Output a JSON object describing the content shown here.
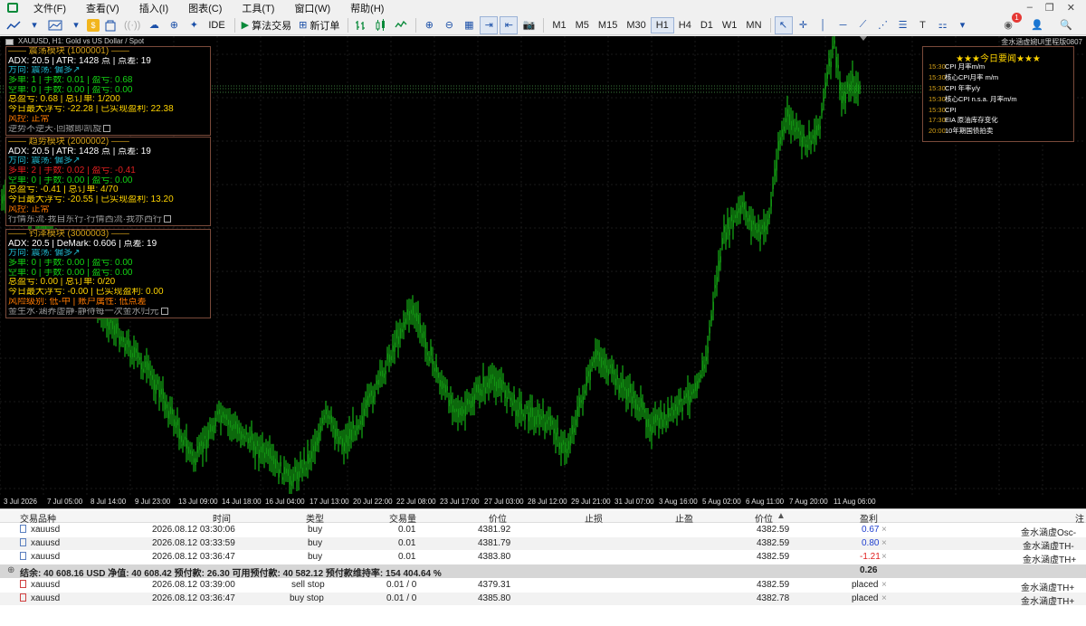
{
  "menu": {
    "items": [
      "文件(F)",
      "查看(V)",
      "插入(I)",
      "图表(C)",
      "工具(T)",
      "窗口(W)",
      "帮助(H)"
    ]
  },
  "toolbar": {
    "ide_label": "IDE",
    "algo_label": "算法交易",
    "new_order_label": "新订单",
    "timeframes": [
      "M1",
      "M5",
      "M15",
      "M30",
      "H1",
      "H4",
      "D1",
      "W1",
      "MN"
    ],
    "active_timeframe": "H1",
    "notification_count": "1"
  },
  "chart": {
    "title": "XAUUSD, H1:  Gold vs US Dollar / Spot",
    "top_right_label": "金水涵虚婉UI里程版0807",
    "x_labels": [
      "3 Jul 2026",
      "7 Jul 05:00",
      "8 Jul 14:00",
      "9 Jul 23:00",
      "13 Jul 09:00",
      "14 Jul 18:00",
      "16 Jul 04:00",
      "17 Jul 13:00",
      "20 Jul 22:00",
      "22 Jul 08:00",
      "23 Jul 17:00",
      "27 Jul 03:00",
      "28 Jul 12:00",
      "29 Jul 21:00",
      "31 Jul 07:00",
      "3 Aug 16:00",
      "5 Aug 02:00",
      "6 Aug 11:00",
      "7 Aug 20:00",
      "11 Aug 06:00"
    ],
    "candle_color": "#19d219",
    "background": "#000000"
  },
  "panels": [
    {
      "header": "—— 震荡模块 (1000001) ——",
      "lines": [
        {
          "text": "ADX: 20.5 | ATR: 1428 点 | 点差: 19",
          "color": "white"
        },
        {
          "text": "方向: 震荡:   偏多↗",
          "color": "cyan"
        },
        {
          "text": "多单: 1 | 手数: 0.01 | 盈亏: 0.68",
          "color": "green"
        },
        {
          "text": "空单: 0 | 手数: 0.00 | 盈亏: 0.00",
          "color": "green"
        },
        {
          "text": "总盈亏: 0.68  |  总订单: 1/200",
          "color": "yellow"
        },
        {
          "text": "今日最大浮亏: -22.28 | 已实现盈利: 22.38",
          "color": "yellow"
        },
        {
          "text": "风控: 正常",
          "color": "orange"
        },
        {
          "text": "逆势不逆天·回撤即凯旋",
          "color": "gray"
        }
      ]
    },
    {
      "header": "—— 趋势模块 (2000002) ——",
      "lines": [
        {
          "text": "ADX: 20.5 | ATR: 1428 点 | 点差: 19",
          "color": "white"
        },
        {
          "text": "方向: 震荡:   偏多↗",
          "color": "cyan"
        },
        {
          "text": "多单: 2 | 手数: 0.02 | 盈亏: -0.41",
          "color": "red"
        },
        {
          "text": "空单: 0 | 手数: 0.00 | 盈亏: 0.00",
          "color": "green"
        },
        {
          "text": "总盈亏: -0.41  |  总订单: 4/70",
          "color": "yellow"
        },
        {
          "text": "今日最大浮亏: -20.55 | 已实现盈利: 13.20",
          "color": "yellow"
        },
        {
          "text": "风控: 正常",
          "color": "orange"
        },
        {
          "text": "行情东流·我自东行·行情西流·我亦西行",
          "color": "gray"
        }
      ]
    },
    {
      "header": "—— 钓泽模块 (3000003) ——",
      "lines": [
        {
          "text": "ADX: 20.5 | DeMark: 0.606 | 点差: 19",
          "color": "white"
        },
        {
          "text": "方向: 震荡:   偏多↗",
          "color": "cyan"
        },
        {
          "text": "多单: 0 | 手数: 0.00 | 盈亏: 0.00",
          "color": "green"
        },
        {
          "text": "空单: 0 | 手数: 0.00 | 盈亏: 0.00",
          "color": "green"
        },
        {
          "text": "总盈亏: 0.00  |  总订单: 0/20",
          "color": "yellow"
        },
        {
          "text": "今日最大浮亏: -0.00 | 已实现盈利: 0.00",
          "color": "yellow"
        },
        {
          "text": "风险级别: 低-中 | 账户属性: 低点差",
          "color": "orange"
        },
        {
          "text": "金生水·涵养虚静·静待每一次金水归元",
          "color": "gray"
        }
      ]
    }
  ],
  "news": {
    "title": "★★★今日要闻★★★",
    "items": [
      {
        "time": "15:30",
        "text": "CPI 月率m/m"
      },
      {
        "time": "15:30",
        "text": "核心CPI月率 m/m"
      },
      {
        "time": "15:30",
        "text": "CPI 年率y/y"
      },
      {
        "time": "15:30",
        "text": "核心CPI n.s.a. 月率m/m"
      },
      {
        "time": "15:30",
        "text": "CPI"
      },
      {
        "time": "17:30",
        "text": "EIA 原油库存变化"
      },
      {
        "time": "20:00",
        "text": "10年期国债拍卖"
      }
    ]
  },
  "terminal": {
    "headers": {
      "symbol": "交易品种",
      "time": "时间",
      "type": "类型",
      "volume": "交易量",
      "price": "价位",
      "sl": "止损",
      "tp": "止盈",
      "cur_price": "价位",
      "profit": "盈利",
      "comment": "注"
    },
    "positions": [
      {
        "symbol": "xauusd",
        "time": "2026.08.12 03:30:06",
        "type": "buy",
        "volume": "0.01",
        "price": "4381.92",
        "cur_price": "4382.59",
        "profit": "0.67",
        "comment": "金水涵虚Osc-"
      },
      {
        "symbol": "xauusd",
        "time": "2026.08.12 03:33:59",
        "type": "buy",
        "volume": "0.01",
        "price": "4381.79",
        "cur_price": "4382.59",
        "profit": "0.80",
        "comment": "金水涵虚TH-"
      },
      {
        "symbol": "xauusd",
        "time": "2026.08.12 03:36:47",
        "type": "buy",
        "volume": "0.01",
        "price": "4383.80",
        "cur_price": "4382.59",
        "profit": "-1.21",
        "comment": "金水涵虚TH+"
      }
    ],
    "summary": {
      "text": "结余: 40 608.16 USD  净值: 40 608.42  预付款: 26.30  可用预付款: 40 582.12  预付款维持率: 154 404.64 %",
      "total": "0.26"
    },
    "orders": [
      {
        "symbol": "xauusd",
        "time": "2026.08.12 03:39:00",
        "type": "sell stop",
        "volume": "0.01 / 0",
        "price": "4379.31",
        "cur_price": "4382.59",
        "status": "placed",
        "comment": "金水涵虚TH+"
      },
      {
        "symbol": "xauusd",
        "time": "2026.08.12 03:36:47",
        "type": "buy stop",
        "volume": "0.01 / 0",
        "price": "4385.80",
        "cur_price": "4382.78",
        "status": "placed",
        "comment": "金水涵虚TH+"
      }
    ]
  }
}
